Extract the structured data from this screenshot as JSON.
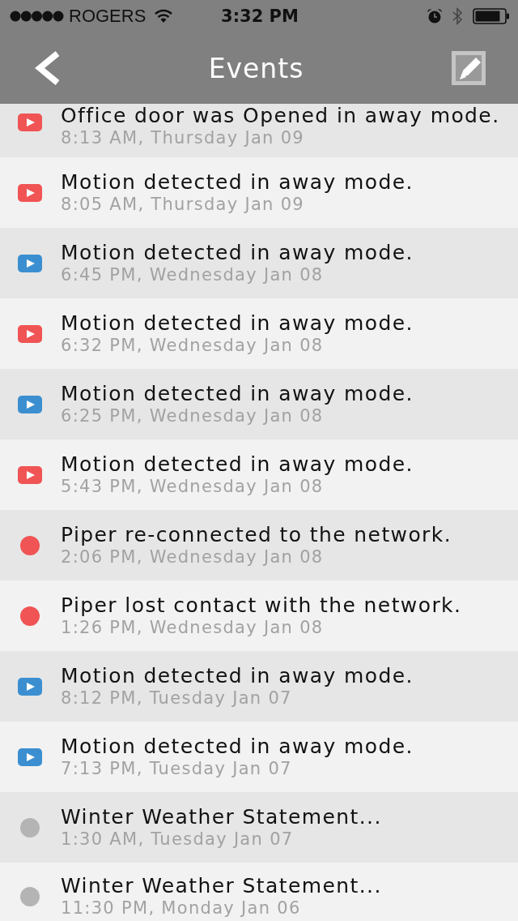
{
  "status_bar": {
    "carrier": "ROGERS",
    "time": "3:32 PM"
  },
  "nav_bar": {
    "title": "Events"
  },
  "events": [
    {
      "kind": "video",
      "color": "#f05454",
      "title": "Office door was Opened in away mode.",
      "time": "8:13 AM, Thursday Jan 09"
    },
    {
      "kind": "video",
      "color": "#f05454",
      "title": "Motion detected in away mode.",
      "time": "8:05 AM, Thursday Jan 09"
    },
    {
      "kind": "video",
      "color": "#3b8fd0",
      "title": "Motion detected in away mode.",
      "time": "6:45 PM, Wednesday Jan 08"
    },
    {
      "kind": "video",
      "color": "#f05454",
      "title": "Motion detected in away mode.",
      "time": "6:32 PM, Wednesday Jan 08"
    },
    {
      "kind": "video",
      "color": "#3b8fd0",
      "title": "Motion detected in away mode.",
      "time": "6:25 PM, Wednesday Jan 08"
    },
    {
      "kind": "video",
      "color": "#f05454",
      "title": "Motion detected in away mode.",
      "time": "5:43 PM, Wednesday Jan 08"
    },
    {
      "kind": "dot",
      "color": "#f05454",
      "title": "Piper re-connected to the network.",
      "time": "2:06 PM, Wednesday Jan 08"
    },
    {
      "kind": "dot",
      "color": "#f05454",
      "title": "Piper lost contact with the network.",
      "time": "1:26 PM, Wednesday Jan 08"
    },
    {
      "kind": "video",
      "color": "#3b8fd0",
      "title": "Motion detected in away mode.",
      "time": "8:12 PM, Tuesday Jan 07"
    },
    {
      "kind": "video",
      "color": "#3b8fd0",
      "title": "Motion detected in away mode.",
      "time": "7:13 PM, Tuesday Jan 07"
    },
    {
      "kind": "dot",
      "color": "#b4b4b4",
      "title": "Winter Weather Statement...",
      "time": "1:30 AM, Tuesday Jan 07"
    },
    {
      "kind": "dot",
      "color": "#b4b4b4",
      "title": "Winter Weather Statement...",
      "time": "11:30 PM, Monday Jan 06"
    }
  ]
}
